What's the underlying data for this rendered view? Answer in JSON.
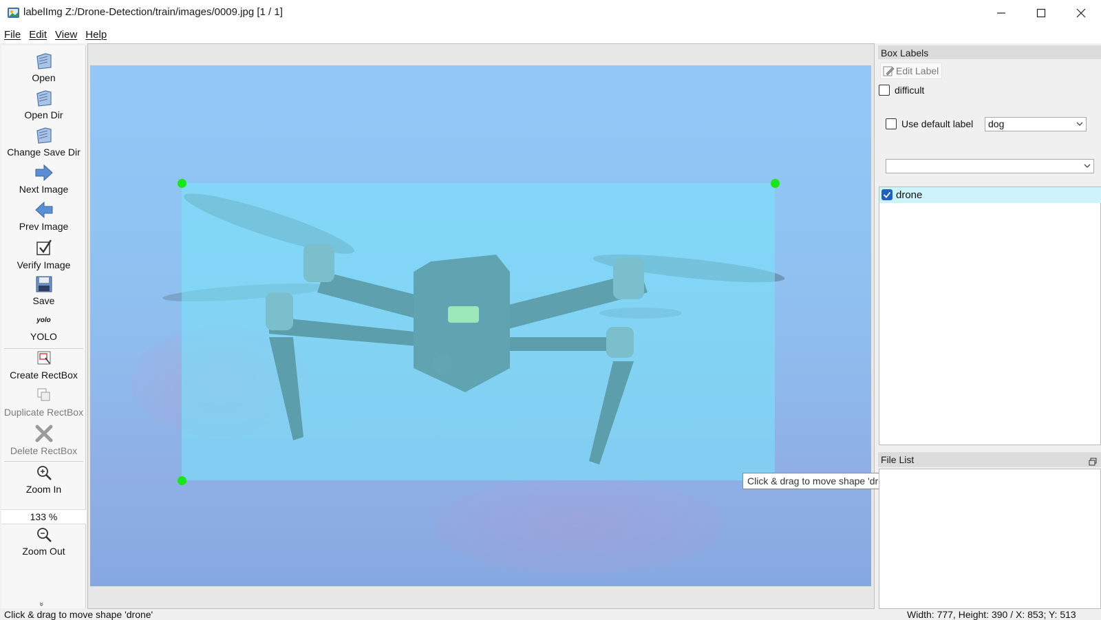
{
  "window": {
    "title": "labelImg Z:/Drone-Detection/train/images/0009.jpg [1 / 1]",
    "icon": "labelimg-app-icon",
    "controls": [
      "minimize-icon",
      "maximize-icon",
      "close-icon"
    ]
  },
  "menu": {
    "items": [
      {
        "accel": "F",
        "rest": "ile"
      },
      {
        "accel": "E",
        "rest": "dit"
      },
      {
        "accel": "V",
        "rest": "iew"
      },
      {
        "accel": "H",
        "rest": "elp"
      }
    ]
  },
  "toolbar": {
    "open": "Open",
    "open_dir": "Open Dir",
    "change_save_dir": "Change Save Dir",
    "next_image": "Next Image",
    "prev_image": "Prev Image",
    "verify_image": "Verify Image",
    "save": "Save",
    "format_icon_text": "yolo",
    "format": "YOLO",
    "create_rectbox": "Create RectBox",
    "duplicate_rectbox": "Duplicate RectBox",
    "delete_rectbox": "Delete RectBox",
    "zoom_in": "Zoom In",
    "zoom_value": "133 %",
    "zoom_out": "Zoom Out",
    "more": "»"
  },
  "canvas": {
    "shape_label": "drone",
    "tooltip": "Click & drag to move shape 'drone'",
    "box_color": "#78e6fa",
    "handle_color": "#19e619"
  },
  "box_labels": {
    "title": "Box Labels",
    "edit_label": "Edit Label",
    "difficult": "difficult",
    "difficult_checked": false,
    "use_default_label": "Use default label",
    "use_default_checked": false,
    "default_label_value": "dog",
    "label_filter_value": "",
    "labels": [
      {
        "name": "drone",
        "checked": true
      }
    ]
  },
  "file_list": {
    "title": "File List",
    "files": []
  },
  "status": {
    "message": "Click & drag to move shape 'drone'",
    "info": "Width: 777, Height: 390 / X: 853; Y: 513"
  }
}
